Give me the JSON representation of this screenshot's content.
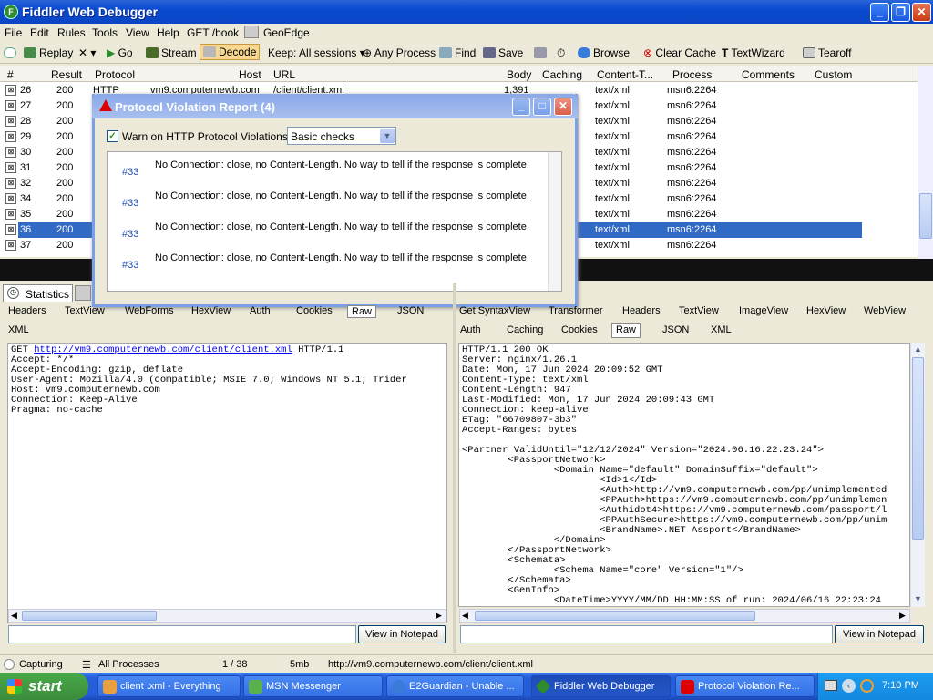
{
  "window": {
    "title": "Fiddler Web Debugger"
  },
  "menu": [
    "File",
    "Edit",
    "Rules",
    "Tools",
    "View",
    "Help",
    "GET /book",
    "GeoEdge"
  ],
  "toolbar": {
    "replay": "Replay",
    "go": "Go",
    "stream": "Stream",
    "decode": "Decode",
    "keep": "Keep: All sessions",
    "process": "Any Process",
    "find": "Find",
    "save": "Save",
    "browse": "Browse",
    "clear_cache": "Clear Cache",
    "textwizard": "TextWizard",
    "tearoff": "Tearoff"
  },
  "grid": {
    "columns": [
      "#",
      "Result",
      "Protocol",
      "Host",
      "URL",
      "Body",
      "Caching",
      "Content-T...",
      "Process",
      "Comments",
      "Custom"
    ],
    "first_row": {
      "protocol": "HTTP",
      "host": "vm9.computernewb.com",
      "url": "/client/client.xml",
      "body": "1,391"
    },
    "rows": [
      {
        "id": "26",
        "result": "200",
        "type": "text/xml",
        "process": "msn6:2264"
      },
      {
        "id": "27",
        "result": "200",
        "type": "text/xml",
        "process": "msn6:2264"
      },
      {
        "id": "28",
        "result": "200",
        "type": "text/xml",
        "process": "msn6:2264"
      },
      {
        "id": "29",
        "result": "200",
        "type": "text/xml",
        "process": "msn6:2264"
      },
      {
        "id": "30",
        "result": "200",
        "type": "text/xml",
        "process": "msn6:2264"
      },
      {
        "id": "31",
        "result": "200",
        "type": "text/xml",
        "process": "msn6:2264"
      },
      {
        "id": "32",
        "result": "200",
        "type": "text/xml",
        "process": "msn6:2264"
      },
      {
        "id": "34",
        "result": "200",
        "type": "text/xml",
        "process": "msn6:2264"
      },
      {
        "id": "35",
        "result": "200",
        "type": "text/xml",
        "process": "msn6:2264"
      },
      {
        "id": "36",
        "result": "200",
        "type": "text/xml",
        "process": "msn6:2264"
      },
      {
        "id": "37",
        "result": "200",
        "type": "text/xml",
        "process": "msn6:2264"
      }
    ],
    "selected_row_id": "36"
  },
  "dialog": {
    "title": "Protocol Violation Report (4)",
    "checkbox_label": "Warn on HTTP Protocol Violations",
    "checkbox_checked": true,
    "select_value": "Basic checks",
    "violations": [
      {
        "id": "#33",
        "msg": "No Connection: close, no Content-Length. No way to tell if the response is complete."
      },
      {
        "id": "#33",
        "msg": "No Connection: close, no Content-Length. No way to tell if the response is complete."
      },
      {
        "id": "#33",
        "msg": "No Connection: close, no Content-Length. No way to tell if the response is complete."
      },
      {
        "id": "#33",
        "msg": "No Connection: close, no Content-Length. No way to tell if the response is complete."
      }
    ]
  },
  "left_tabs": {
    "statistics": "Statistics"
  },
  "request_tabs": {
    "row1": [
      "Headers",
      "TextView",
      "WebForms",
      "HexView",
      "Auth",
      "Cookies",
      "Raw",
      "JSON"
    ],
    "row2": [
      "XML"
    ],
    "active": "Raw"
  },
  "request": {
    "line1_method": "GET ",
    "line1_url": "http://vm9.computernewb.com/client/client.xml",
    "line1_ver": " HTTP/1.1",
    "lines": [
      "Accept: */*",
      "Accept-Encoding: gzip, deflate",
      "User-Agent: Mozilla/4.0 (compatible; MSIE 7.0; Windows NT 5.1; Trider",
      "Host: vm9.computernewb.com",
      "Connection: Keep-Alive",
      "Pragma: no-cache"
    ],
    "notepad_button": "View in Notepad"
  },
  "response_tabs": {
    "row1": [
      "Get SyntaxView",
      "Transformer",
      "Headers",
      "TextView",
      "ImageView",
      "HexView",
      "WebView"
    ],
    "row2": [
      "Auth",
      "Caching",
      "Cookies",
      "Raw",
      "JSON",
      "XML"
    ],
    "active": "Raw"
  },
  "response": {
    "lines": [
      "HTTP/1.1 200 OK",
      "Server: nginx/1.26.1",
      "Date: Mon, 17 Jun 2024 20:09:52 GMT",
      "Content-Type: text/xml",
      "Content-Length: 947",
      "Last-Modified: Mon, 17 Jun 2024 20:09:43 GMT",
      "Connection: keep-alive",
      "ETag: \"66709807-3b3\"",
      "Accept-Ranges: bytes",
      "",
      "<Partner ValidUntil=\"12/12/2024\" Version=\"2024.06.16.22.23.24\">",
      "        <PassportNetwork>",
      "                <Domain Name=\"default\" DomainSuffix=\"default\">",
      "                        <Id>1</Id>",
      "                        <Auth>http://vm9.computernewb.com/pp/unimplemented",
      "                        <PPAuth>https://vm9.computernewb.com/pp/unimplemen",
      "                        <Authidot4>https://vm9.computernewb.com/passport/l",
      "                        <PPAuthSecure>https://vm9.computernewb.com/pp/unim",
      "                        <BrandName>.NET Assport</BrandName>",
      "                </Domain>",
      "        </PassportNetwork>",
      "        <Schemata>",
      "                <Schema Name=\"core\" Version=\"1\"/>",
      "        </Schemata>",
      "        <GenInfo>",
      "                <DateTime>YYYY/MM/DD HH:MM:SS of run: 2024/06/16 22:23:24"
    ],
    "notepad_button": "View in Notepad"
  },
  "status": {
    "capturing": "Capturing",
    "processes": "All Processes",
    "count": "1 / 38",
    "size": "5mb",
    "url": "http://vm9.computernewb.com/client/client.xml"
  },
  "taskbar": {
    "start": "start",
    "tasks": [
      "client .xml - Everything",
      "MSN Messenger",
      "E2Guardian - Unable ...",
      "Fiddler Web Debugger",
      "Protocol Violation Re..."
    ],
    "clock": "7:10 PM"
  }
}
